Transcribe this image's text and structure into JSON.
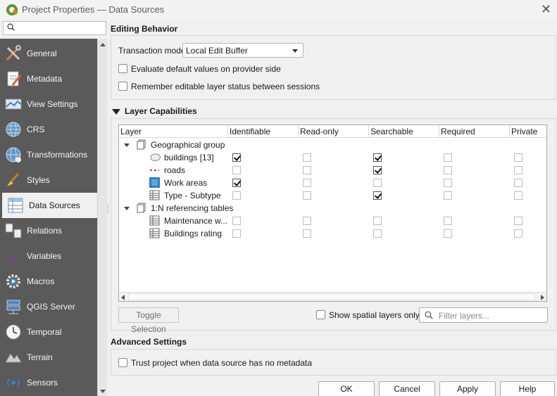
{
  "window": {
    "title": "Project Properties — Data Sources",
    "close_glyph": "✕"
  },
  "search": {
    "placeholder": ""
  },
  "sidebar": {
    "items": [
      {
        "label": "General",
        "icon": "wrench-screwdriver-icon",
        "active": false
      },
      {
        "label": "Metadata",
        "icon": "metadata-pencil-icon",
        "active": false
      },
      {
        "label": "View Settings",
        "icon": "map-view-icon",
        "active": false
      },
      {
        "label": "CRS",
        "icon": "globe-icon",
        "active": false
      },
      {
        "label": "Transformations",
        "icon": "globe-transform-icon",
        "active": false
      },
      {
        "label": "Styles",
        "icon": "paint-brush-icon",
        "active": false
      },
      {
        "label": "Data Sources",
        "icon": "data-sources-table-icon",
        "active": true
      },
      {
        "label": "Relations",
        "icon": "relations-icon",
        "active": false
      },
      {
        "label": "Variables",
        "icon": "epsilon-icon",
        "active": false
      },
      {
        "label": "Macros",
        "icon": "macros-gear-icon",
        "active": false
      },
      {
        "label": "QGIS Server",
        "icon": "server-icon",
        "active": false
      },
      {
        "label": "Temporal",
        "icon": "clock-icon",
        "active": false
      },
      {
        "label": "Terrain",
        "icon": "terrain-icon",
        "active": false
      },
      {
        "label": "Sensors",
        "icon": "sensors-icon",
        "active": false
      }
    ]
  },
  "editing": {
    "title": "Editing Behavior",
    "transaction_label": "Transaction mode",
    "transaction_value": "Local Edit Buffer",
    "eval_defaults_label": "Evaluate default values on provider side",
    "eval_defaults_checked": false,
    "remember_status_label": "Remember editable layer status between sessions",
    "remember_status_checked": false
  },
  "capabilities": {
    "title": "Layer Capabilities",
    "columns": [
      "Layer",
      "Identifiable",
      "Read-only",
      "Searchable",
      "Required",
      "Private"
    ],
    "rows": [
      {
        "name": "Geographical group",
        "type": "group",
        "icon": "group-icon",
        "flags": null
      },
      {
        "name": "buildings [13]",
        "type": "layer",
        "icon": "polygon-layer-icon",
        "flags": [
          true,
          false,
          true,
          false,
          false
        ]
      },
      {
        "name": "roads",
        "type": "layer",
        "icon": "line-layer-icon",
        "flags": [
          false,
          false,
          true,
          false,
          false
        ]
      },
      {
        "name": "Work areas",
        "type": "layer",
        "icon": "raster-layer-icon",
        "flags": [
          true,
          false,
          false,
          false,
          false
        ]
      },
      {
        "name": "Type - Subtype",
        "type": "layer",
        "icon": "table-layer-icon",
        "flags": [
          false,
          false,
          true,
          false,
          false
        ]
      },
      {
        "name": "1:N referencing tables",
        "type": "group",
        "icon": "group-icon",
        "flags": null
      },
      {
        "name": "Maintenance w...",
        "type": "layer",
        "icon": "table-layer-icon",
        "flags": [
          false,
          false,
          false,
          false,
          false
        ]
      },
      {
        "name": "Buildings rating",
        "type": "layer",
        "icon": "table-layer-icon",
        "flags": [
          false,
          false,
          false,
          false,
          false
        ]
      }
    ],
    "toggle_selection_label": "Toggle Selection",
    "show_spatial_label": "Show spatial layers only",
    "show_spatial_checked": false,
    "filter_placeholder": "Filter layers..."
  },
  "advanced": {
    "title": "Advanced Settings",
    "trust_label": "Trust project when data source has no metadata",
    "trust_checked": false
  },
  "buttons": {
    "ok": "OK",
    "cancel": "Cancel",
    "apply": "Apply",
    "help": "Help"
  },
  "colors": {
    "sidebar_bg": "#5a5a5a",
    "qgis_green": "#589632",
    "qgis_orange": "#ee7913"
  }
}
